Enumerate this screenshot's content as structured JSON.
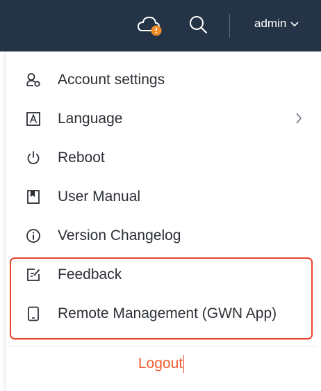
{
  "topbar": {
    "username": "admin",
    "icons": {
      "cloud": "cloud-alert-icon",
      "search": "search-icon",
      "user_menu": "chevron-down-icon"
    },
    "colors": {
      "background": "#243446",
      "alert": "#f28c28"
    }
  },
  "menu": {
    "items": [
      {
        "label": "Account settings",
        "icon": "account-settings-icon"
      },
      {
        "label": "Language",
        "icon": "language-icon",
        "has_submenu": true
      },
      {
        "label": "Reboot",
        "icon": "power-icon"
      },
      {
        "label": "User Manual",
        "icon": "book-icon"
      },
      {
        "label": "Version Changelog",
        "icon": "info-icon"
      },
      {
        "label": "Feedback",
        "icon": "feedback-icon"
      },
      {
        "label": "Remote Management (GWN App)",
        "icon": "mobile-device-icon"
      }
    ],
    "logout_label": "Logout",
    "colors": {
      "logout": "#ef5a2f",
      "highlight": "#e8432a"
    }
  }
}
